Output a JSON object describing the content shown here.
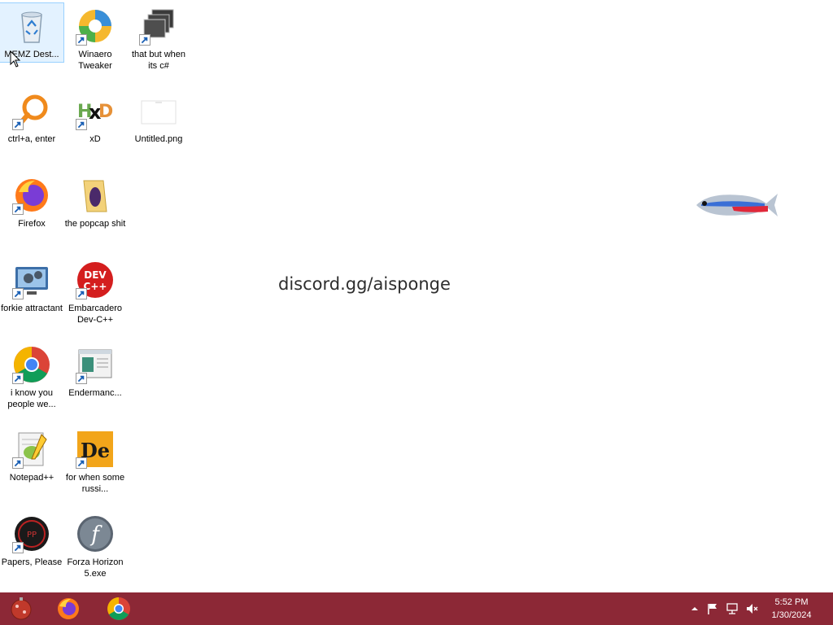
{
  "desktop": {
    "wallpaper_text": "discord.gg/aisponge",
    "icons": [
      {
        "label": "MEMZ Dest...",
        "icon": "recycle-bin-icon"
      },
      {
        "label": "Winaero Tweaker",
        "icon": "winaero-icon"
      },
      {
        "label": "that but when its c#",
        "icon": "stacked-windows-icon"
      },
      {
        "label": "ctrl+a, enter",
        "icon": "orange-magnifier-icon"
      },
      {
        "label": "xD",
        "icon": "hxd-icon"
      },
      {
        "label": "Untitled.png",
        "icon": "image-file-icon"
      },
      {
        "label": "Firefox",
        "icon": "firefox-icon"
      },
      {
        "label": "the popcap shit",
        "icon": "folder-icon"
      },
      {
        "label": "forkie attractant",
        "icon": "computer-settings-icon"
      },
      {
        "label": "Embarcadero Dev-C++",
        "icon": "devcpp-icon"
      },
      {
        "label": "i know you people we...",
        "icon": "chrome-icon"
      },
      {
        "label": "Endermanc...",
        "icon": "window-app-icon"
      },
      {
        "label": "Notepad++",
        "icon": "notepadpp-icon"
      },
      {
        "label": "for when some russi...",
        "icon": "de-icon"
      },
      {
        "label": "Papers, Please",
        "icon": "papers-please-icon"
      },
      {
        "label": "Forza Horizon 5.exe",
        "icon": "flash-icon"
      }
    ]
  },
  "taskbar": {
    "pinned": [
      {
        "name": "start",
        "icon": "ornament-start-icon"
      },
      {
        "name": "firefox",
        "icon": "firefox-icon"
      },
      {
        "name": "chrome",
        "icon": "chrome-icon"
      }
    ],
    "tray": {
      "icons": [
        "chevron-up-icon",
        "flag-icon",
        "network-icon",
        "volume-muted-icon"
      ],
      "time": "5:52 PM",
      "date": "1/30/2024"
    }
  },
  "colors": {
    "taskbar": "#8c2836",
    "selection": "#cce8ff"
  }
}
